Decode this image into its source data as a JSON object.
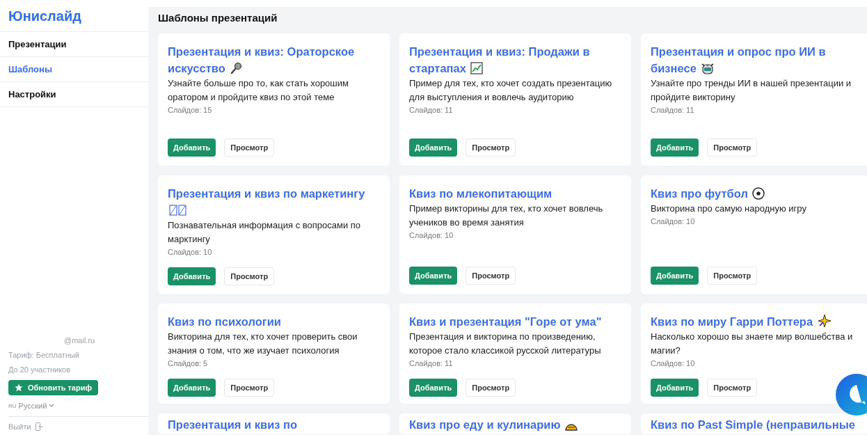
{
  "sidebar": {
    "logo": "Юнислайд",
    "nav": [
      {
        "label": "Презентации",
        "selected": false
      },
      {
        "label": "Шаблоны",
        "selected": true
      },
      {
        "label": "Настройки",
        "selected": false
      }
    ],
    "email": "@mail.ru",
    "plan": "Тариф: Бесплатный",
    "limit": "До 20 участников",
    "upgrade_button": "Обновить тариф",
    "language": {
      "code": "RU",
      "label": "Русский"
    },
    "logout": "Выйти"
  },
  "page_title": "Шаблоны презентаций",
  "templates": [
    {
      "title": "Презентация и квиз: Ораторское искусство",
      "description": "Узнайте больше про то, как стать хорошим оратором и пройдите квиз по этой теме",
      "slides": "Слайдов: 15",
      "add_button": "Добавить",
      "preview_button": "Просмотр"
    },
    {
      "title": "Презентация и квиз: Продажи в стартапах",
      "description": "Пример для тех, кто хочет создать презентацию для выступления и вовлечь аудиторию",
      "slides": "Слайдов: 11",
      "add_button": "Добавить",
      "preview_button": "Просмотр"
    },
    {
      "title": "Презентация и опрос про ИИ в бизнесе",
      "description": "Узнайте про тренды ИИ в нашей презентации и пройдите викторину",
      "slides": "Слайдов: 11",
      "add_button": "Добавить",
      "preview_button": "Просмотр"
    },
    {
      "title": "Презентация и квиз по маркетингу",
      "description": "Познавательная информация с вопросами по марктингу",
      "slides": "Слайдов: 10",
      "add_button": "Добавить",
      "preview_button": "Просмотр"
    },
    {
      "title": "Квиз по млекопитающим",
      "description": "Пример викторины для тех, кто хочет вовлечь учеников во время занятия",
      "slides": "Слайдов: 10",
      "add_button": "Добавить",
      "preview_button": "Просмотр"
    },
    {
      "title": "Квиз про футбол",
      "description": "Викторина про самую народную игру",
      "slides": "Слайдов: 10",
      "add_button": "Добавить",
      "preview_button": "Просмотр"
    },
    {
      "title": "Квиз по психологии",
      "description": "Викторина для тех, кто хочет проверить свои знания о том, что же изучает психология",
      "slides": "Слайдов: 5",
      "add_button": "Добавить",
      "preview_button": "Просмотр"
    },
    {
      "title": "Квиз и презентация \"Горе от ума\"",
      "description": "Презентация и викторина по произведению, которое стало классикой русской литературы",
      "slides": "Слайдов: 11",
      "add_button": "Добавить",
      "preview_button": "Просмотр"
    },
    {
      "title": "Квиз по миру Гарри Поттера",
      "description": "Насколько хорошо вы знаете мир волшебства и магии?",
      "slides": "Слайдов: 10",
      "add_button": "Добавить",
      "preview_button": "Просмотр"
    },
    {
      "title": "Презентация и квиз по"
    },
    {
      "title": "Квиз про еду и кулинарию"
    },
    {
      "title": "Квиз по Past Simple (неправильные"
    }
  ]
}
